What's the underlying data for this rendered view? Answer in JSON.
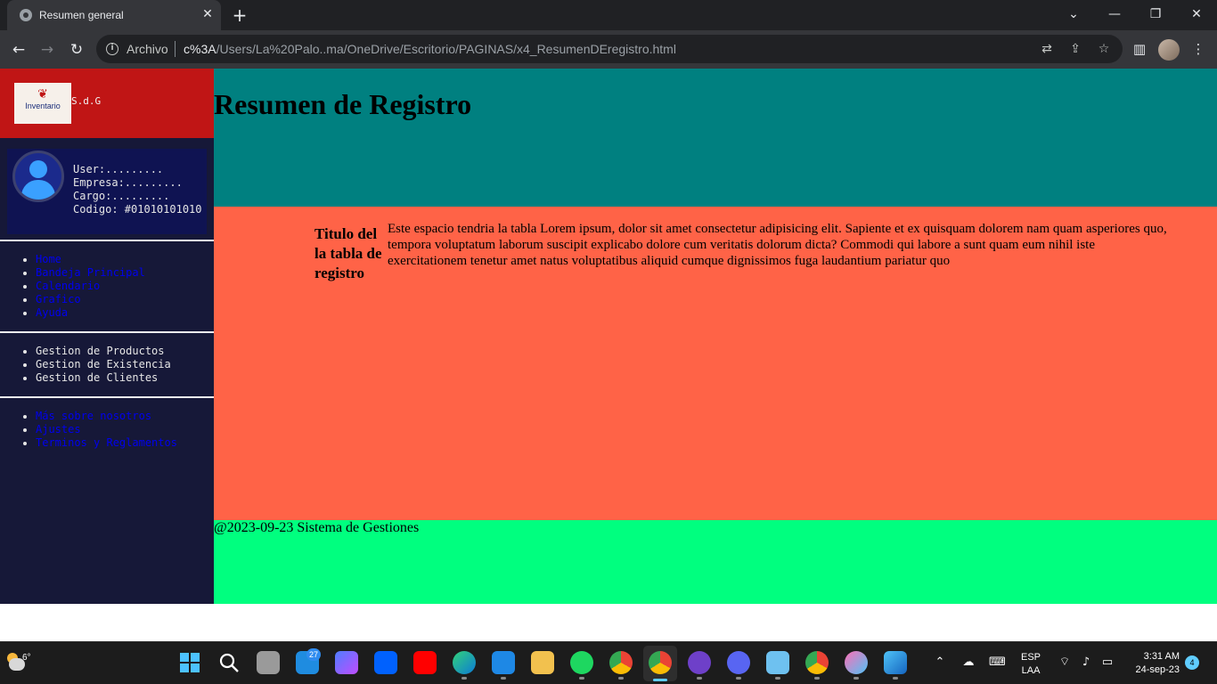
{
  "browser": {
    "tab_title": "Resumen general",
    "tab_close_glyph": "✕",
    "new_tab_glyph": "+",
    "url_scheme": "Archivo",
    "url_host": "c%3A",
    "url_path": "/Users/La%20Palo..ma/OneDrive/Escritorio/PAGINAS/x4_ResumenDEregistro.html"
  },
  "sidebar": {
    "brand_name": "S.d.G",
    "logo_text": "Inventario",
    "profile": {
      "user": "User:.........",
      "empresa": "Empresa:.........",
      "cargo": "Cargo:.........",
      "codigo": "Codigo: #01010101010"
    },
    "nav_links": [
      "Home",
      "Bandeja Principal",
      "Calendario",
      "Grafico",
      "Ayuda"
    ],
    "management": [
      "Gestion de Productos",
      "Gestion de Existencia",
      "Gestion de Clientes"
    ],
    "extra_links": [
      "Más sobre nosotros",
      "Ajustes",
      "Terminos y Reglamentos"
    ]
  },
  "header": {
    "title": "Resumen de Registro"
  },
  "content": {
    "table_title": "Titulo del la tabla de registro",
    "table_text": "Este espacio tendria la tabla Lorem ipsum, dolor sit amet consectetur adipisicing elit. Sapiente et ex quisquam dolorem nam quam asperiores quo, tempora voluptatum laborum suscipit explicabo dolore cum veritatis dolorum dicta? Commodi qui labore a sunt quam eum nihil iste exercitationem tenetur amet natus voluptatibus aliquid cumque dignissimos fuga laudantium pariatur quo"
  },
  "footer": {
    "text": "@2023-09-23 Sistema de Gestiones"
  },
  "taskbar": {
    "weather_temp": "6°",
    "mail_badge": "27",
    "lang_line1": "ESP",
    "lang_line2": "LAA",
    "time": "3:31 AM",
    "date": "24-sep-23",
    "notification_count": "4"
  },
  "colors": {
    "brand": "#c01515",
    "sidebar": "#161838",
    "header": "#008080",
    "content": "#ff6347",
    "footer": "#00ff7f"
  }
}
